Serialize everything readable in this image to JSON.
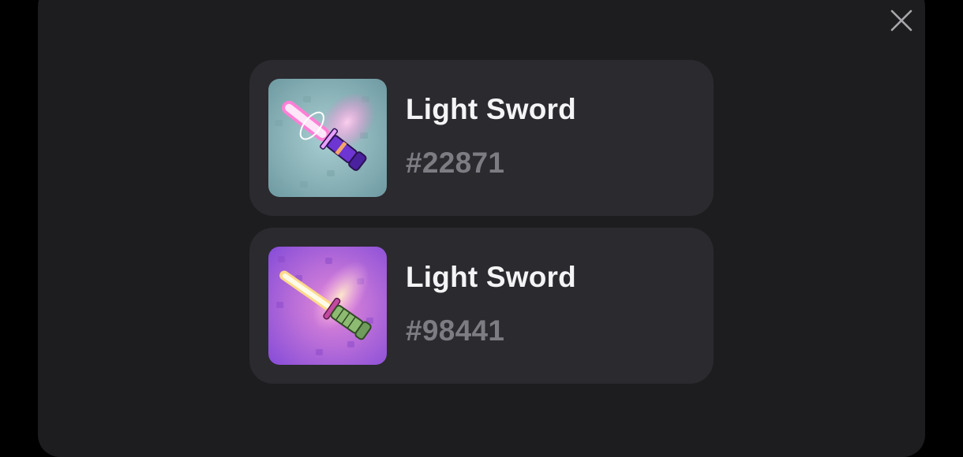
{
  "colors": {
    "page_background": "#000000",
    "modal_background": "#1d1d1f",
    "card_background": "#2b2a2f",
    "title_text": "#f4f4f6",
    "token_text": "#7d7c82",
    "close_icon": "#a7a7ab"
  },
  "modal": {
    "close_icon": "close-icon"
  },
  "items": [
    {
      "name": "Light Sword",
      "token_id": "#22871",
      "thumbnail_icon": "light-sword-pink-icon",
      "thumbnail_background": "#84b0b6",
      "blade_color": "#ff6fd2",
      "hilt_color": "#5b2bb8"
    },
    {
      "name": "Light Sword",
      "token_id": "#98441",
      "thumbnail_icon": "light-sword-yellow-icon",
      "thumbnail_background": "#a35de0",
      "blade_color": "#ffe9a8",
      "hilt_color": "#7fae66"
    }
  ]
}
